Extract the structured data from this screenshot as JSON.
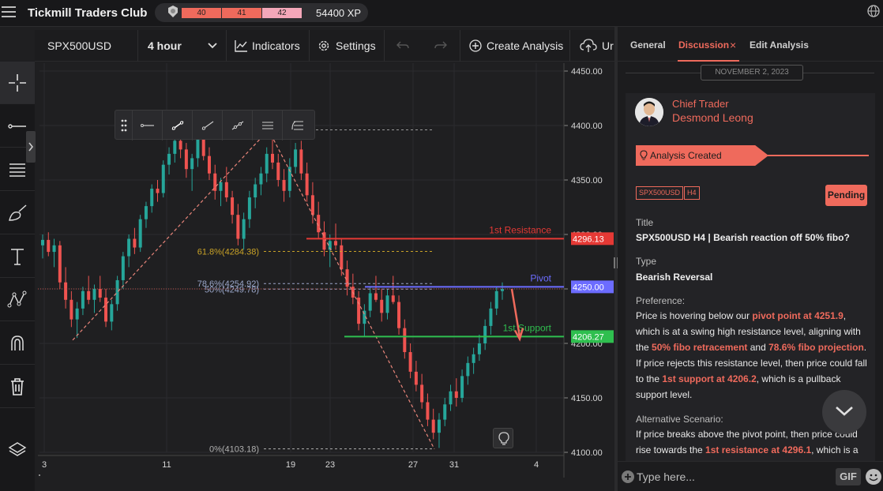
{
  "app": {
    "title": "Tickmill Traders Club"
  },
  "xp": {
    "levels": [
      "40",
      "41",
      "42"
    ],
    "label": "54400 XP"
  },
  "toolbar": {
    "symbol": "SPX500USD",
    "interval": "4 hour",
    "indicators": "Indicators",
    "settings": "Settings",
    "create_analysis": "Create Analysis",
    "upload": "Ur"
  },
  "chart_data": {
    "type": "candlestick",
    "symbol": "SPX500USD",
    "interval": "4 hour",
    "y_ticks": [
      "4450.00",
      "4400.00",
      "4350.00",
      "4300.00",
      "4250.00",
      "4200.00",
      "4150.00",
      "4100.00"
    ],
    "ylim": [
      4100,
      4450
    ],
    "x_ticks": [
      "3",
      "11",
      "19",
      "23",
      "27",
      "31",
      "4"
    ],
    "levels": [
      {
        "name": "1st Resistance",
        "value": 4296.13,
        "label": "4296.13",
        "color": "#e53935"
      },
      {
        "name": "Pivot",
        "value": 4251.9,
        "label": "4250.00",
        "color": "#6c6cff"
      },
      {
        "name": "1st Support",
        "value": 4206.27,
        "label": "4206.27",
        "color": "#2fbf4f"
      }
    ],
    "fib_levels": [
      {
        "label": "61.8%(4284.38)",
        "value": 4284.38,
        "color": "#c9a227"
      },
      {
        "label": "78.6%(4254.92)",
        "value": 4254.92,
        "color": "#9aa6c9"
      },
      {
        "label": "50%(4249.78)",
        "value": 4249.78,
        "color": "#9aa6c9"
      },
      {
        "label": "0%(4103.18)",
        "value": 4103.18,
        "color": "#b0b0b0"
      }
    ],
    "candles": [
      [
        4290,
        4300,
        4278,
        4295
      ],
      [
        4295,
        4302,
        4280,
        4284
      ],
      [
        4284,
        4296,
        4270,
        4290
      ],
      [
        4290,
        4294,
        4250,
        4256
      ],
      [
        4256,
        4270,
        4232,
        4240
      ],
      [
        4240,
        4248,
        4215,
        4222
      ],
      [
        4222,
        4238,
        4205,
        4232
      ],
      [
        4232,
        4252,
        4226,
        4248
      ],
      [
        4248,
        4262,
        4236,
        4240
      ],
      [
        4240,
        4254,
        4228,
        4250
      ],
      [
        4250,
        4262,
        4238,
        4242
      ],
      [
        4242,
        4250,
        4215,
        4220
      ],
      [
        4220,
        4240,
        4212,
        4236
      ],
      [
        4236,
        4262,
        4230,
        4258
      ],
      [
        4258,
        4284,
        4250,
        4280
      ],
      [
        4280,
        4300,
        4270,
        4296
      ],
      [
        4296,
        4306,
        4282,
        4288
      ],
      [
        4288,
        4318,
        4284,
        4314
      ],
      [
        4314,
        4330,
        4306,
        4326
      ],
      [
        4326,
        4346,
        4320,
        4342
      ],
      [
        4342,
        4350,
        4330,
        4338
      ],
      [
        4338,
        4368,
        4334,
        4364
      ],
      [
        4364,
        4380,
        4355,
        4374
      ],
      [
        4374,
        4392,
        4366,
        4386
      ],
      [
        4386,
        4396,
        4370,
        4378
      ],
      [
        4378,
        4384,
        4352,
        4360
      ],
      [
        4360,
        4374,
        4340,
        4370
      ],
      [
        4370,
        4394,
        4362,
        4390
      ],
      [
        4390,
        4398,
        4368,
        4372
      ],
      [
        4372,
        4380,
        4350,
        4356
      ],
      [
        4356,
        4364,
        4332,
        4340
      ],
      [
        4340,
        4352,
        4326,
        4348
      ],
      [
        4348,
        4362,
        4330,
        4334
      ],
      [
        4334,
        4340,
        4310,
        4318
      ],
      [
        4318,
        4328,
        4290,
        4296
      ],
      [
        4296,
        4320,
        4286,
        4314
      ],
      [
        4314,
        4340,
        4306,
        4334
      ],
      [
        4334,
        4352,
        4324,
        4346
      ],
      [
        4346,
        4362,
        4336,
        4356
      ],
      [
        4356,
        4380,
        4348,
        4374
      ],
      [
        4374,
        4388,
        4360,
        4366
      ],
      [
        4366,
        4374,
        4344,
        4350
      ],
      [
        4350,
        4360,
        4330,
        4340
      ],
      [
        4340,
        4370,
        4334,
        4362
      ],
      [
        4362,
        4384,
        4356,
        4378
      ],
      [
        4378,
        4386,
        4350,
        4356
      ],
      [
        4356,
        4366,
        4330,
        4336
      ],
      [
        4336,
        4348,
        4310,
        4318
      ],
      [
        4318,
        4330,
        4296,
        4302
      ],
      [
        4302,
        4312,
        4280,
        4286
      ],
      [
        4286,
        4300,
        4270,
        4294
      ],
      [
        4294,
        4310,
        4286,
        4290
      ],
      [
        4290,
        4296,
        4262,
        4268
      ],
      [
        4268,
        4276,
        4244,
        4252
      ],
      [
        4252,
        4264,
        4236,
        4242
      ],
      [
        4242,
        4248,
        4212,
        4218
      ],
      [
        4218,
        4236,
        4206,
        4230
      ],
      [
        4230,
        4252,
        4224,
        4246
      ],
      [
        4246,
        4262,
        4238,
        4240
      ],
      [
        4240,
        4250,
        4220,
        4228
      ],
      [
        4228,
        4250,
        4222,
        4244
      ],
      [
        4244,
        4262,
        4236,
        4238
      ],
      [
        4238,
        4244,
        4208,
        4214
      ],
      [
        4214,
        4222,
        4186,
        4192
      ],
      [
        4192,
        4200,
        4168,
        4174
      ],
      [
        4174,
        4184,
        4156,
        4162
      ],
      [
        4162,
        4172,
        4140,
        4146
      ],
      [
        4146,
        4154,
        4124,
        4130
      ],
      [
        4130,
        4140,
        4112,
        4118
      ],
      [
        4118,
        4136,
        4104,
        4130
      ],
      [
        4130,
        4150,
        4124,
        4144
      ],
      [
        4144,
        4162,
        4138,
        4156
      ],
      [
        4156,
        4168,
        4142,
        4150
      ],
      [
        4150,
        4176,
        4146,
        4170
      ],
      [
        4170,
        4188,
        4162,
        4182
      ],
      [
        4182,
        4196,
        4172,
        4190
      ],
      [
        4190,
        4208,
        4184,
        4200
      ],
      [
        4200,
        4222,
        4194,
        4216
      ],
      [
        4216,
        4238,
        4208,
        4232
      ],
      [
        4232,
        4252,
        4226,
        4248
      ],
      [
        4248,
        4256,
        4240,
        4250
      ]
    ]
  },
  "drawbar": {
    "icons": [
      "drag-handle-icon",
      "horizontal-ray-icon",
      "trend-line-icon",
      "ray-icon",
      "extended-line-icon",
      "parallel-channel-icon",
      "fib-retracement-icon"
    ]
  },
  "panel": {
    "tabs": [
      {
        "label": "General"
      },
      {
        "label": "Discussion",
        "close": "×"
      },
      {
        "label": "Edit Analysis"
      }
    ],
    "date": "NOVEMBER 2, 2023",
    "author": {
      "role": "Chief Trader",
      "name": "Desmond Leong"
    },
    "banner": "Analysis Created",
    "tags": [
      "SPX500USD",
      "H4"
    ],
    "status": "Pending",
    "title_label": "Title",
    "title_value": "SPX500USD H4 | Bearish reaction off 50% fibo?",
    "type_label": "Type",
    "type_value": "Bearish Reversal",
    "pref_label": "Preference:",
    "pref": {
      "t1": "Price is hovering below our ",
      "h1": "pivot point at 4251.9",
      "t2": ", which is at a swing high resistance level, aligning with the ",
      "h2": "50% fibo retracement",
      "t3": " and ",
      "h3": "78.6% fibo projection",
      "t4": ". If price rejects this resistance level, then price could fall to the ",
      "h4": "1st support at 4206.2",
      "t5": ", which is a pullback support level."
    },
    "alt_label": "Alternative Scenario:",
    "alt": {
      "t1": "If price breaks above the pivot point, then price could rise towards the ",
      "h1": "1st resistance at 4296.1",
      "t2": ", which is a"
    }
  },
  "composer": {
    "placeholder": "Type here...",
    "gif": "GIF"
  },
  "colors": {
    "accent": "#ef6a5c",
    "bull": "#26a69a",
    "bear": "#ef5350"
  }
}
